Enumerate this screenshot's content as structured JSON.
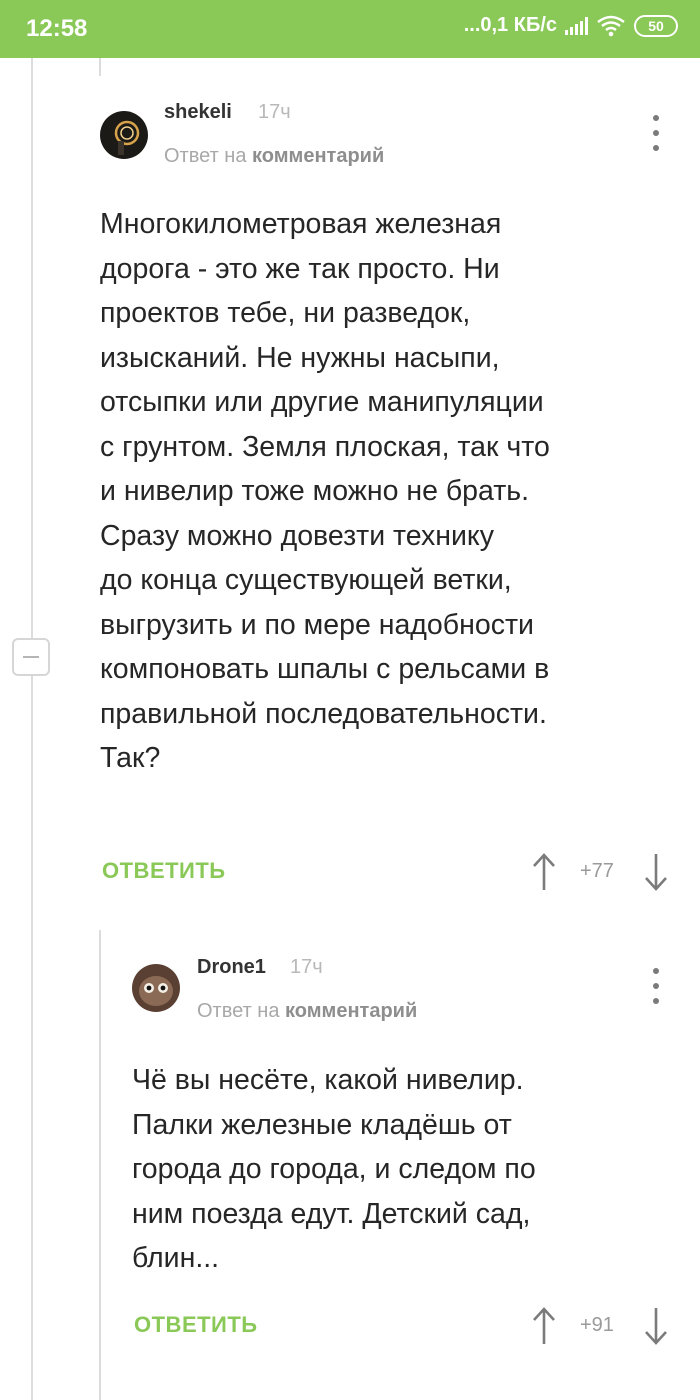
{
  "status_bar": {
    "time": "12:58",
    "network_speed": "...0,1 КБ/с",
    "battery": "50",
    "accent_color": "#8ac858"
  },
  "comments": [
    {
      "username": "shekeli",
      "time_ago": "17ч",
      "reply_prefix": "Ответ на",
      "reply_target": "комментарий",
      "text": "Многокилометровая железная\nдорога - это же так просто. Ни\nпроектов тебе, ни разведок,\nизысканий. Не нужны насыпи,\nотсыпки или другие манипуляции\nс грунтом. Земля плоская, так что\nи нивелир тоже можно не брать.\nСразу можно довезти технику\nдо конца существующей ветки,\nвыгрузить и по мере надобности\nкомпоновать шпалы с рельсами в\nправильной последовательности.\nТак?",
      "reply_label": "ОТВЕТИТЬ",
      "score": "+77",
      "up_icon": "arrow-up-icon",
      "down_icon": "arrow-down-icon",
      "menu_icon": "more-vertical-icon"
    },
    {
      "username": "Drone1",
      "time_ago": "17ч",
      "reply_prefix": "Ответ на",
      "reply_target": "комментарий",
      "text": "Чё вы несёте, какой нивелир.\nПалки железные кладёшь от\nгорода до города, и следом по\nним поезда едут. Детский сад,\nблин...",
      "reply_label": "ОТВЕТИТЬ",
      "score": "+91",
      "up_icon": "arrow-up-icon",
      "down_icon": "arrow-down-icon",
      "menu_icon": "more-vertical-icon"
    }
  ]
}
